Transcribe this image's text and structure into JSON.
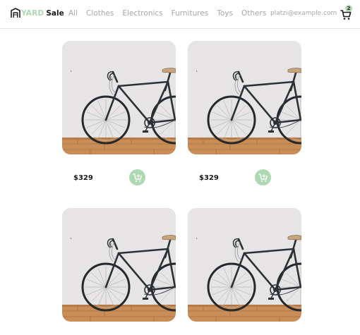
{
  "brand": {
    "yard": "YARD",
    "sale": "Sale"
  },
  "nav": {
    "items": [
      {
        "label": "All"
      },
      {
        "label": "Clothes"
      },
      {
        "label": "Electronics"
      },
      {
        "label": "Furnitures"
      },
      {
        "label": "Toys"
      },
      {
        "label": "Others"
      }
    ]
  },
  "account": {
    "email": "platzi@example.com"
  },
  "cart": {
    "count": "2",
    "icon": "shopping-cart-icon"
  },
  "products": [
    {
      "price": "$329",
      "image": "bicycle-photo",
      "action_icon": "add-to-cart-icon"
    },
    {
      "price": "$329",
      "image": "bicycle-photo",
      "action_icon": "add-to-cart-icon"
    },
    {
      "price": "",
      "image": "bicycle-photo",
      "action_icon": "add-to-cart-icon"
    },
    {
      "price": "",
      "image": "bicycle-photo",
      "action_icon": "add-to-cart-icon"
    }
  ],
  "colors": {
    "accent": "#acd9b2",
    "muted_text": "#a6a6a6",
    "dark_text": "#1a1a1a",
    "divider": "#e3e3e3"
  }
}
